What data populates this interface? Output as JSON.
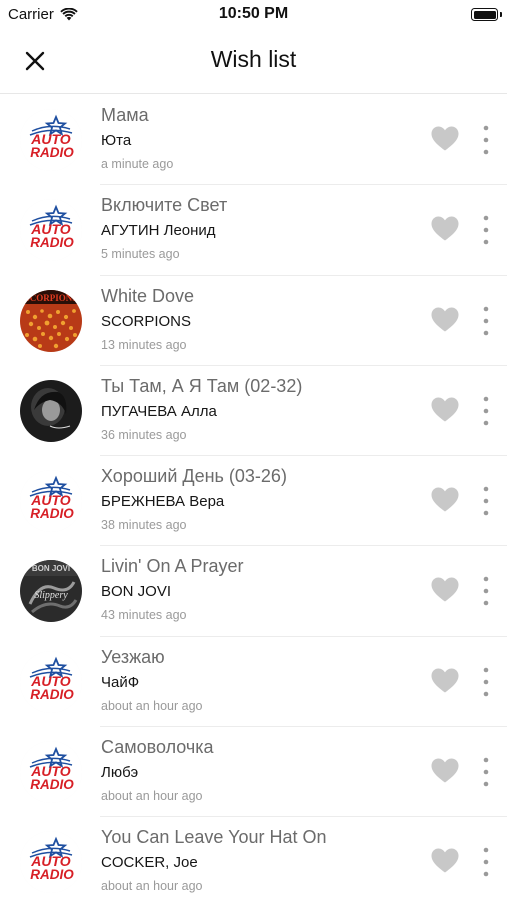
{
  "status_bar": {
    "carrier": "Carrier",
    "time": "10:50 PM"
  },
  "header": {
    "title": "Wish list",
    "close_icon": "close-icon"
  },
  "icons": {
    "favorite": "heart-icon",
    "more": "more-vertical-icon"
  },
  "colors": {
    "heart": "#c8c8c8",
    "radio_red": "#d71f26",
    "radio_blue": "#1f4fa0"
  },
  "items": [
    {
      "title": "Мама",
      "artist": "Юта",
      "time": "a minute ago",
      "cover": "autoradio"
    },
    {
      "title": "Включите Свет",
      "artist": "АГУТИН Леонид",
      "time": "5 minutes ago",
      "cover": "autoradio"
    },
    {
      "title": "White Dove",
      "artist": "SCORPIONS",
      "time": "13 minutes ago",
      "cover": "scorpions"
    },
    {
      "title": "Ты Там, А Я Там (02-32)",
      "artist": "ПУГАЧЕВА Алла",
      "time": "36 minutes ago",
      "cover": "pugacheva"
    },
    {
      "title": "Хороший День (03-26)",
      "artist": "БРЕЖНЕВА Вера",
      "time": "38 minutes ago",
      "cover": "autoradio"
    },
    {
      "title": "Livin' On A Prayer",
      "artist": "BON JOVI",
      "time": "43 minutes ago",
      "cover": "bonjovi"
    },
    {
      "title": "Уезжаю",
      "artist": "ЧайФ",
      "time": "about an hour ago",
      "cover": "autoradio"
    },
    {
      "title": "Самоволочка",
      "artist": "Любэ",
      "time": "about an hour ago",
      "cover": "autoradio"
    },
    {
      "title": "You Can Leave Your Hat On",
      "artist": "COCKER, Joe",
      "time": "about an hour ago",
      "cover": "autoradio"
    }
  ]
}
